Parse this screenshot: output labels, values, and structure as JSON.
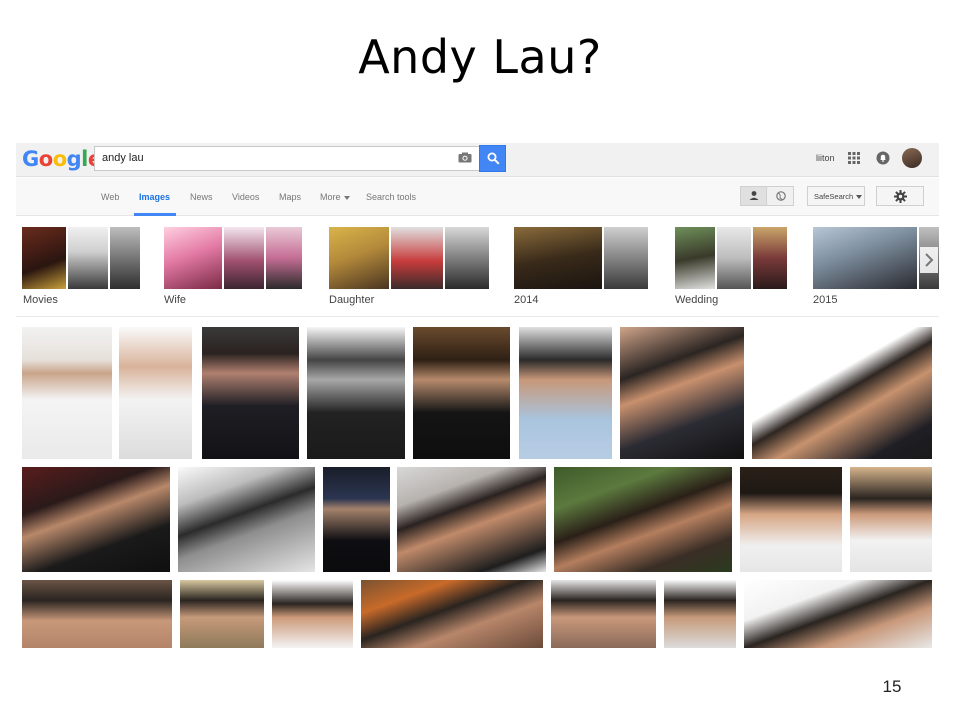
{
  "slide": {
    "title": "Andy Lau?",
    "number": "15"
  },
  "topbar": {
    "logo": "Google",
    "search_query": "andy lau",
    "user_name": "liiton"
  },
  "nav": {
    "tabs": [
      "Web",
      "Images",
      "News",
      "Videos",
      "Maps",
      "More",
      "Search tools"
    ],
    "active_tab": "Images",
    "safesearch_label": "SafeSearch"
  },
  "related": {
    "labels": [
      "Movies",
      "Wife",
      "Daughter",
      "2014",
      "Wedding",
      "2015"
    ]
  },
  "colors": {
    "google_blue": "#4285f4",
    "google_red": "#ea4335",
    "google_yellow": "#fbbc05",
    "google_green": "#34a853",
    "active_tab": "#1a73e8"
  },
  "icons": [
    "camera-icon",
    "search-icon",
    "apps-grid-icon",
    "bell-icon",
    "person-icon",
    "globe-icon",
    "gear-icon",
    "chevron-right-icon"
  ]
}
